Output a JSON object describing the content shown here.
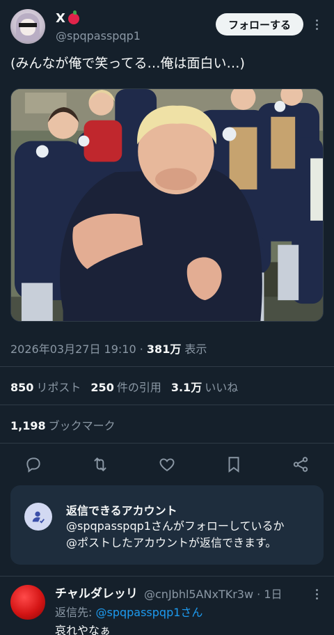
{
  "author": {
    "display_name": "X",
    "handle": "@spqpasspqp1",
    "follow_label": "フォローする"
  },
  "tweet": {
    "text": "(みんなが俺で笑ってる…俺は面白い…)",
    "timestamp": "2026年03月27日 19:10",
    "separator": "·",
    "views_count": "381万",
    "views_label": "表示",
    "reposts_count": "850",
    "reposts_label": "リポスト",
    "quotes_count": "250",
    "quotes_label": "件の引用",
    "likes_count": "3.1万",
    "likes_label": "いいね",
    "bookmarks_count": "1,198",
    "bookmarks_label": "ブックマーク"
  },
  "reply_restriction": {
    "title": "返信できるアカウント",
    "line1": "@spqpasspqp1さんがフォローしているか",
    "line2": "@ポストしたアカウントが返信できます。"
  },
  "reply": {
    "display_name": "チャルダレッリ",
    "handle_time": "@cnJbhl5ANxTKr3w · 1日",
    "reply_to_prefix": "返信先: ",
    "reply_to_handle": "@spqpasspqp1さん",
    "text": "哀れやなぁ"
  },
  "icons": [
    "avatar-apple-emoji",
    "more-icon",
    "reply-icon",
    "repost-icon",
    "like-icon",
    "bookmark-icon",
    "share-icon",
    "reply-restriction-icon"
  ],
  "colors": {
    "background": "#15202b",
    "accent": "#1d9bf0",
    "muted": "#8b98a5",
    "card": "#1e2d3d"
  }
}
